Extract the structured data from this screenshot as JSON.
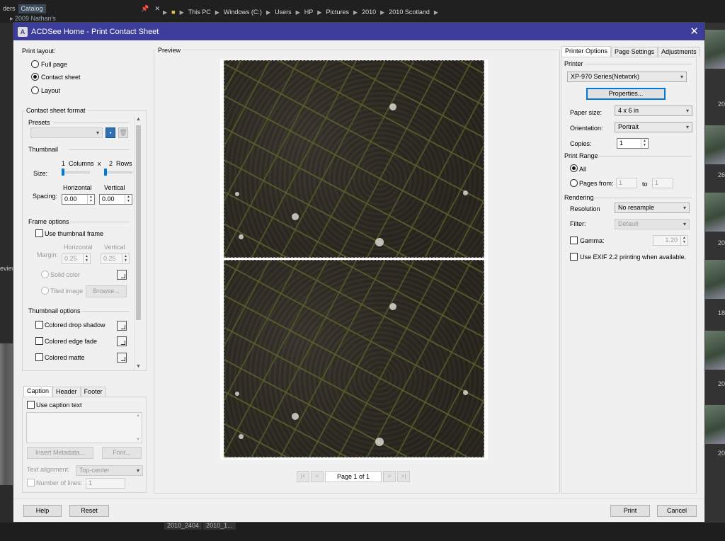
{
  "background": {
    "panel_tabs": [
      "ders",
      "Catalog"
    ],
    "folder_item": "2009 Nathan's",
    "breadcrumb": [
      "This PC",
      "Windows (C:)",
      "Users",
      "HP",
      "Pictures",
      "2010",
      "2010 Scotland"
    ],
    "review_label": "eview",
    "right_numbers": [
      "20",
      "20",
      "26",
      "20",
      "G",
      "18",
      "20",
      "20"
    ],
    "bottom_tabs": [
      "2010_2404",
      "2010_1..."
    ]
  },
  "dialog": {
    "title": "ACDSee Home - Print Contact Sheet",
    "close_glyph": "✕"
  },
  "print_layout": {
    "label": "Print layout:",
    "options": [
      "Full page",
      "Contact sheet",
      "Layout"
    ],
    "selected": "Contact sheet"
  },
  "contact_sheet_format": {
    "group_label": "Contact sheet format",
    "presets_label": "Presets",
    "thumbnail_label": "Thumbnail",
    "columns_value": "1",
    "columns_label": "Columns",
    "x_label": "x",
    "rows_value": "2",
    "rows_label": "Rows",
    "size_label": "Size:",
    "horizontal_label": "Horizontal",
    "vertical_label": "Vertical",
    "spacing_label": "Spacing:",
    "spacing_h": "0.00",
    "spacing_v": "0.00",
    "frame_options_label": "Frame options",
    "use_thumbnail_frame": "Use thumbnail frame",
    "margin_label": "Margin:",
    "margin_h_label": "Horizontal",
    "margin_v_label": "Vertical",
    "margin_h": "0.25",
    "margin_v": "0.25",
    "solid_color": "Solid color",
    "tiled_image": "Tiled image",
    "browse": "Browse...",
    "thumbnail_options_label": "Thumbnail options",
    "colored_drop_shadow": "Colored drop shadow",
    "colored_edge_fade": "Colored edge fade",
    "colored_matte": "Colored matte"
  },
  "caption": {
    "tabs": [
      "Caption",
      "Header",
      "Footer"
    ],
    "use_caption_text": "Use caption text",
    "insert_metadata": "Insert Metadata...",
    "font": "Font...",
    "text_alignment_label": "Text alignment:",
    "text_alignment_value": "Top-center",
    "number_of_lines_label": "Number of lines:",
    "number_of_lines_value": "1"
  },
  "preview": {
    "label": "Preview",
    "page_text": "Page 1 of 1",
    "nav": [
      "|<",
      "<",
      ">",
      ">|"
    ]
  },
  "right_panel": {
    "tabs": [
      "Printer Options",
      "Page Settings",
      "Adjustments"
    ],
    "printer_label": "Printer",
    "printer_value": "XP-970 Series(Network)",
    "properties": "Properties...",
    "paper_size_label": "Paper size:",
    "paper_size_value": "4 x 6 in",
    "orientation_label": "Orientation:",
    "orientation_value": "Portrait",
    "copies_label": "Copies:",
    "copies_value": "1",
    "print_range_label": "Print Range",
    "all_label": "All",
    "pages_from_label": "Pages from:",
    "pages_from_value": "1",
    "to_label": "to",
    "pages_to_value": "1",
    "rendering_label": "Rendering",
    "resolution_label": "Resolution",
    "resolution_value": "No resample",
    "filter_label": "Filter:",
    "filter_value": "Default",
    "gamma_label": "Gamma:",
    "gamma_value": "1.20",
    "exif_label": "Use EXIF 2.2 printing when available."
  },
  "footer": {
    "help": "Help",
    "reset": "Reset",
    "print": "Print",
    "cancel": "Cancel"
  },
  "colors": {
    "titlebar": "#3c3d9a",
    "accent": "#0078d7"
  }
}
